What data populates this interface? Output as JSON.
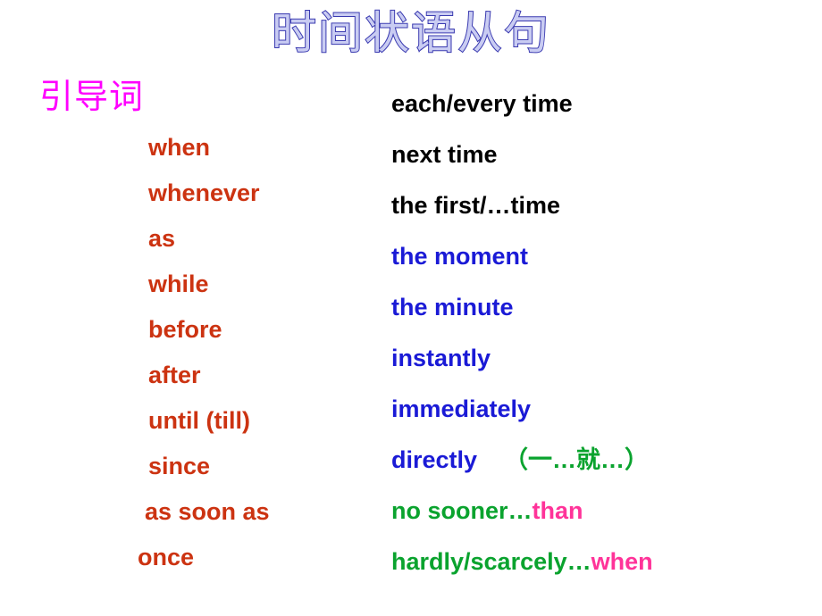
{
  "slide": {
    "title": "时间状语从句",
    "title_fill_color": "#c9ccf2",
    "title_outline_color": "#3a3ab0",
    "background_color": "#ffffff"
  },
  "left_column": {
    "heading": "引导词",
    "heading_color": "#ff00ff",
    "word_color": "#cc3311",
    "items": [
      {
        "text": "when"
      },
      {
        "text": "whenever"
      },
      {
        "text": "as"
      },
      {
        "text": "while"
      },
      {
        "text": "before"
      },
      {
        "text": "after"
      },
      {
        "text": "until (till)"
      },
      {
        "text": "since"
      },
      {
        "text": "as soon as"
      },
      {
        "text": "once"
      }
    ]
  },
  "right_column": {
    "colors": {
      "black": "#000000",
      "blue": "#1a1ad6",
      "green": "#0aa32e",
      "pink": "#ff3399"
    },
    "items": [
      {
        "main": "each/every time",
        "color": "black",
        "note": "",
        "tail": "",
        "tail_color": ""
      },
      {
        "main": "next time",
        "color": "black",
        "note": "",
        "tail": "",
        "tail_color": ""
      },
      {
        "main": "the first/…time",
        "color": "black",
        "note": "",
        "tail": "",
        "tail_color": ""
      },
      {
        "main": "the moment",
        "color": "blue",
        "note": "",
        "tail": "",
        "tail_color": ""
      },
      {
        "main": "the minute",
        "color": "blue",
        "note": "",
        "tail": "",
        "tail_color": ""
      },
      {
        "main": "instantly",
        "color": "blue",
        "note": "",
        "tail": "",
        "tail_color": ""
      },
      {
        "main": "immediately",
        "color": "blue",
        "note": "",
        "tail": "",
        "tail_color": ""
      },
      {
        "main": "directly",
        "color": "blue",
        "note": "（一…就…）",
        "note_color": "green",
        "tail": "",
        "tail_color": ""
      },
      {
        "main": "no sooner…",
        "color": "green",
        "note": "",
        "tail": "than",
        "tail_color": "pink"
      },
      {
        "main": "hardly/scarcely…",
        "color": "green",
        "note": "",
        "tail": "when",
        "tail_color": "pink"
      }
    ]
  }
}
